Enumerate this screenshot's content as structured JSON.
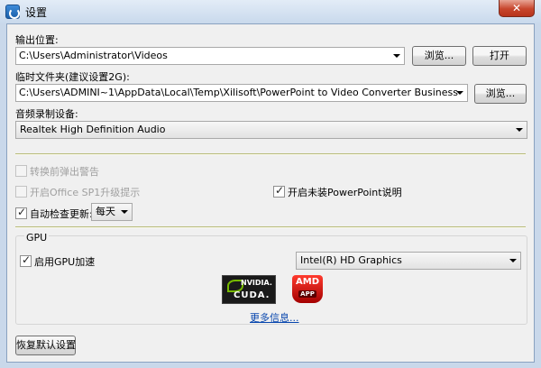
{
  "window": {
    "title": "设置",
    "close_label": "✕"
  },
  "output": {
    "label": "输出位置:",
    "path": "C:\\Users\\Administrator\\Videos",
    "browse_label": "浏览...",
    "open_label": "打开"
  },
  "temp": {
    "label": "临时文件夹(建议设置2G):",
    "path": "C:\\Users\\ADMINI~1\\AppData\\Local\\Temp\\Xilisoft\\PowerPoint to Video Converter Business",
    "browse_label": "浏览..."
  },
  "audio": {
    "label": "音频录制设备:",
    "device": "Realtek High Definition Audio"
  },
  "options": {
    "warn_before_convert": {
      "label": "转换前弹出警告",
      "checked": false,
      "enabled": false
    },
    "office_sp1_prompt": {
      "label": "开启Office SP1升级提示",
      "checked": false,
      "enabled": false
    },
    "ppt_not_installed_note": {
      "label": "开启未装PowerPoint说明",
      "checked": true,
      "enabled": true
    },
    "auto_update": {
      "label": "自动检查更新:",
      "checked": true,
      "enabled": true,
      "frequency": "每天"
    }
  },
  "gpu": {
    "group_title": "GPU",
    "enable_label": "启用GPU加速",
    "enabled": true,
    "device": "Intel(R) HD Graphics",
    "nvidia_text": "NVIDIA.",
    "cuda_text": "CUDA.",
    "amd_text": "AMD",
    "amd_app_text": "APP",
    "more_info_label": "更多信息..."
  },
  "footer": {
    "restore_defaults_label": "恢复默认设置"
  },
  "colors": {
    "link": "#0645ad",
    "nvidia_green": "#76b900",
    "amd_red": "#e2231a",
    "close_red": "#c7452c"
  }
}
